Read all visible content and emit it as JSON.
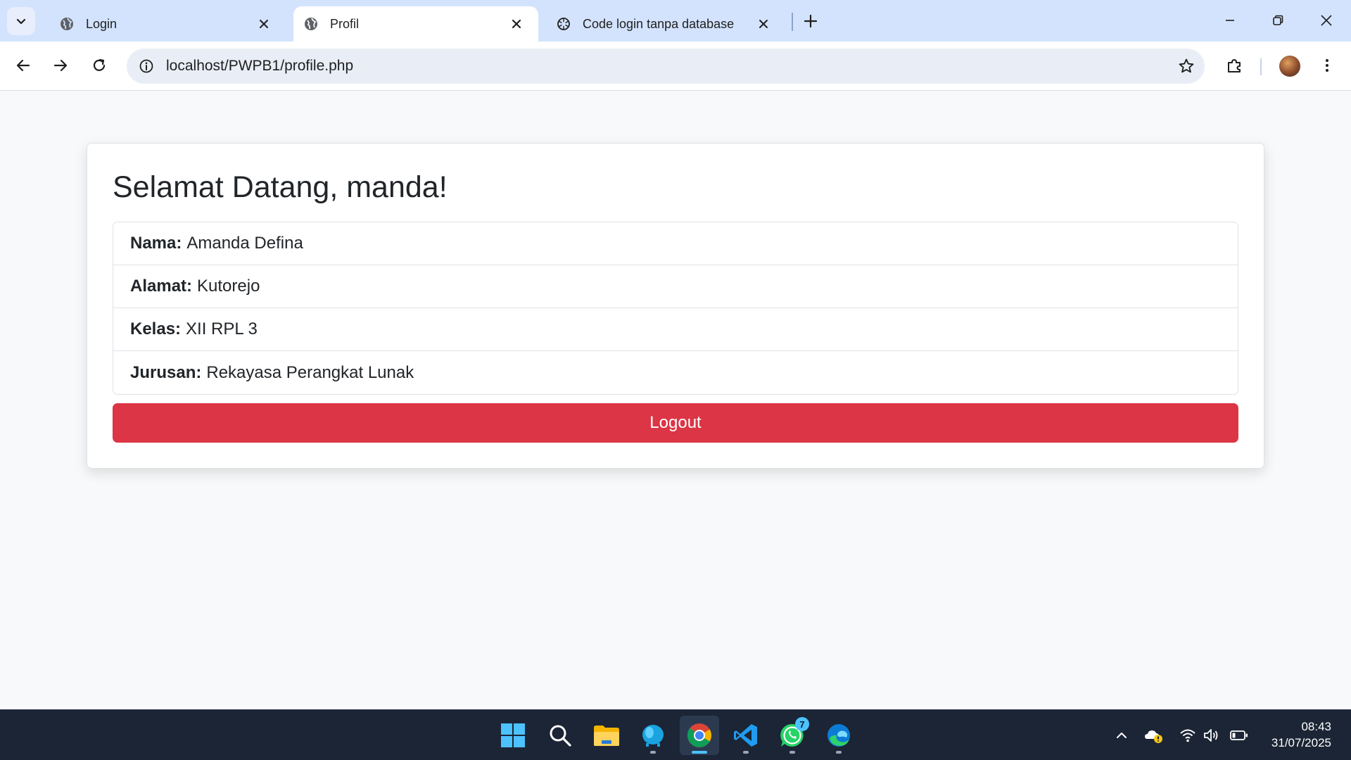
{
  "browser": {
    "tabs": [
      {
        "title": "Login",
        "active": false
      },
      {
        "title": "Profil",
        "active": true
      },
      {
        "title": "Code login tanpa database",
        "active": false
      }
    ],
    "url": "localhost/PWPB1/profile.php"
  },
  "page": {
    "heading": "Selamat Datang, manda!",
    "fields": [
      {
        "label": "Nama:",
        "value": "Amanda Defina"
      },
      {
        "label": "Alamat:",
        "value": "Kutorejo"
      },
      {
        "label": "Kelas:",
        "value": "XII RPL 3"
      },
      {
        "label": "Jurusan:",
        "value": "Rekayasa Perangkat Lunak"
      }
    ],
    "logout_label": "Logout"
  },
  "taskbar": {
    "apps": [
      "start-icon",
      "search-icon",
      "file-explorer-icon",
      "app-icon",
      "chrome-icon",
      "vscode-icon",
      "whatsapp-icon",
      "edge-icon"
    ],
    "whatsapp_badge": "7",
    "time": "08:43",
    "date": "31/07/2025"
  },
  "colors": {
    "tabstrip": "#d3e3fd",
    "danger": "#dc3545",
    "taskbar": "#1b2535",
    "accent": "#4cc2ff"
  }
}
